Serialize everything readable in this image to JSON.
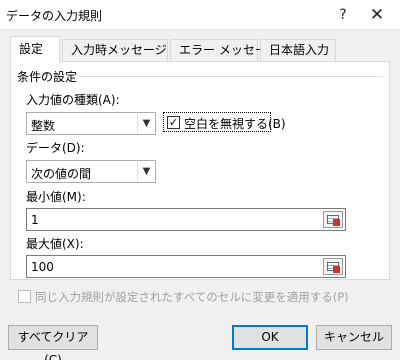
{
  "window": {
    "title": "データの入力規則",
    "help_glyph": "?",
    "close_glyph": "✕"
  },
  "tabs": [
    {
      "label": "設定",
      "active": true
    },
    {
      "label": "入力時メッセージ",
      "active": false
    },
    {
      "label": "エラー メッセージ",
      "active": false
    },
    {
      "label": "日本語入力",
      "active": false
    }
  ],
  "settings": {
    "group_label": "条件の設定",
    "allow_label": "入力値の種類(A):",
    "allow_value": "整数",
    "ignore_blank_label": "空白を無視する(B)",
    "ignore_blank_checked": true,
    "data_label": "データ(D):",
    "data_value": "次の値の間",
    "min_label": "最小値(M):",
    "min_value": "1",
    "max_label": "最大値(X):",
    "max_value": "100",
    "apply_all_label": "同じ入力規則が設定されたすべてのセルに変更を適用する(P)",
    "apply_all_checked": false
  },
  "buttons": {
    "clear_all": "すべてクリア(C)",
    "ok": "OK",
    "cancel": "キャンセル"
  },
  "icons": {
    "dropdown": "chevron-down-icon",
    "range_select": "range-select-icon",
    "close": "close-icon",
    "help": "help-icon"
  }
}
